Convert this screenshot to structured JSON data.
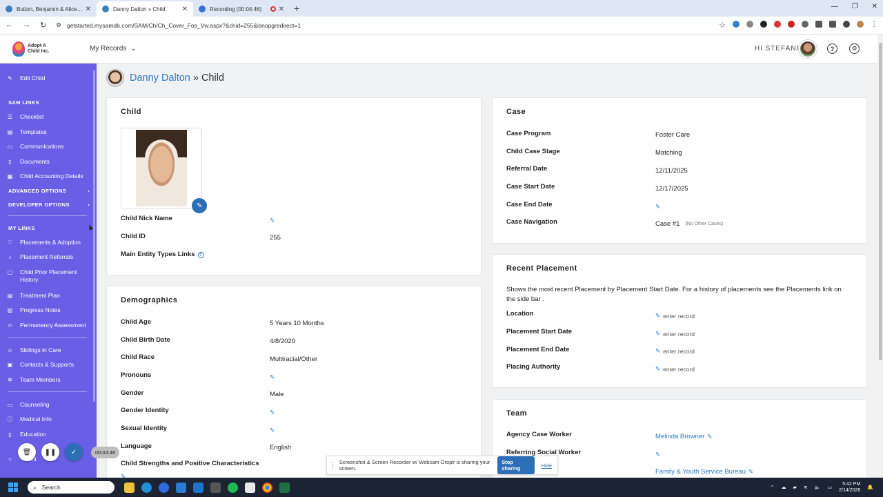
{
  "browser": {
    "tabs": [
      {
        "title": "Button, Benjamin & Alice » Co..."
      },
      {
        "title": "Danny Dalton » Child"
      },
      {
        "title": "Recording (00:04:46)"
      }
    ],
    "url": "getstarted.mysamdb.com/SAM/Ch/Ch_Cover_Fos_Vw.aspx?&chid=255&isnopgredirect=1"
  },
  "header": {
    "logo_line1": "Adopt A",
    "logo_line2": "Child Inc.",
    "my_records": "My Records",
    "greeting": "HI STEFANIE"
  },
  "sidebar": {
    "edit_child": "Edit Child",
    "sam_links_heading": "SAM LINKS",
    "sam_links": [
      "Checklist",
      "Templates",
      "Communications",
      "Documents",
      "Child Accounting Details"
    ],
    "advanced_options": "ADVANCED OPTIONS",
    "developer_options": "DEVELOPER OPTIONS",
    "my_links_heading": "MY LINKS",
    "my_links_group1": [
      "Placements & Adoption",
      "Placement Referrals",
      "Child Prior Placement History",
      "Treatment Plan",
      "Progress Notes",
      "Permanency Assessment"
    ],
    "my_links_group2": [
      "Siblings in Care",
      "Contacts & Supports",
      "Team Members"
    ],
    "my_links_group3": [
      "Counseling",
      "Medical Info",
      "Education",
      "ent"
    ]
  },
  "breadcrumb": {
    "name": "Danny Dalton",
    "separator": "» Child"
  },
  "child_card": {
    "title": "Child",
    "rows": [
      {
        "label": "Child Nick Name",
        "value": ""
      },
      {
        "label": "Child ID",
        "value": "255"
      },
      {
        "label": "Main Entity Types Links",
        "value": ""
      }
    ]
  },
  "demographics_card": {
    "title": "Demographics",
    "rows": [
      {
        "label": "Child Age",
        "value": "5 Years 10 Months"
      },
      {
        "label": "Child Birth Date",
        "value": "4/8/2020"
      },
      {
        "label": "Child Race",
        "value": "Multiracial/Other"
      },
      {
        "label": "Pronouns",
        "value": ""
      },
      {
        "label": "Gender",
        "value": "Male"
      },
      {
        "label": "Gender Identity",
        "value": ""
      },
      {
        "label": "Sexual Identity",
        "value": ""
      },
      {
        "label": "Language",
        "value": "English"
      },
      {
        "label": "Child Strengths and Positive Characteristics",
        "value": ""
      }
    ]
  },
  "case_card": {
    "title": "Case",
    "rows": [
      {
        "label": "Case Program",
        "value": "Foster Care"
      },
      {
        "label": "Child Case Stage",
        "value": "Matching"
      },
      {
        "label": "Referral Date",
        "value": "12/11/2025"
      },
      {
        "label": "Case Start Date",
        "value": "12/17/2025"
      },
      {
        "label": "Case End Date",
        "value": ""
      },
      {
        "label": "Case Navigation",
        "value": "Case #1",
        "note": "(No Other Cases)"
      }
    ]
  },
  "recent_placement_card": {
    "title": "Recent Placement",
    "description": "Shows the most recent Placement by Placement Start Date. For a history of placements see the Placements link on the side bar .",
    "enter_record": "enter record",
    "rows": [
      {
        "label": "Location"
      },
      {
        "label": "Placement Start Date"
      },
      {
        "label": "Placement End Date"
      },
      {
        "label": "Placing Authority"
      }
    ]
  },
  "team_card": {
    "title": "Team",
    "rows": [
      {
        "label": "Agency Case Worker",
        "value": "Melinda Browner"
      },
      {
        "label": "Referring Social Worker",
        "value": ""
      },
      {
        "label": "",
        "value": "Family & Youth Service Bureau"
      }
    ]
  },
  "recorder": {
    "time": "00:04:46"
  },
  "sharebar": {
    "message": "Screenshot & Screen Recorder w/ Webcam-Droplr is sharing your screen.",
    "stop": "Stop sharing",
    "hide": "Hide"
  },
  "taskbar": {
    "search": "Search",
    "time": "5:42 PM",
    "date": "2/14/2026"
  }
}
